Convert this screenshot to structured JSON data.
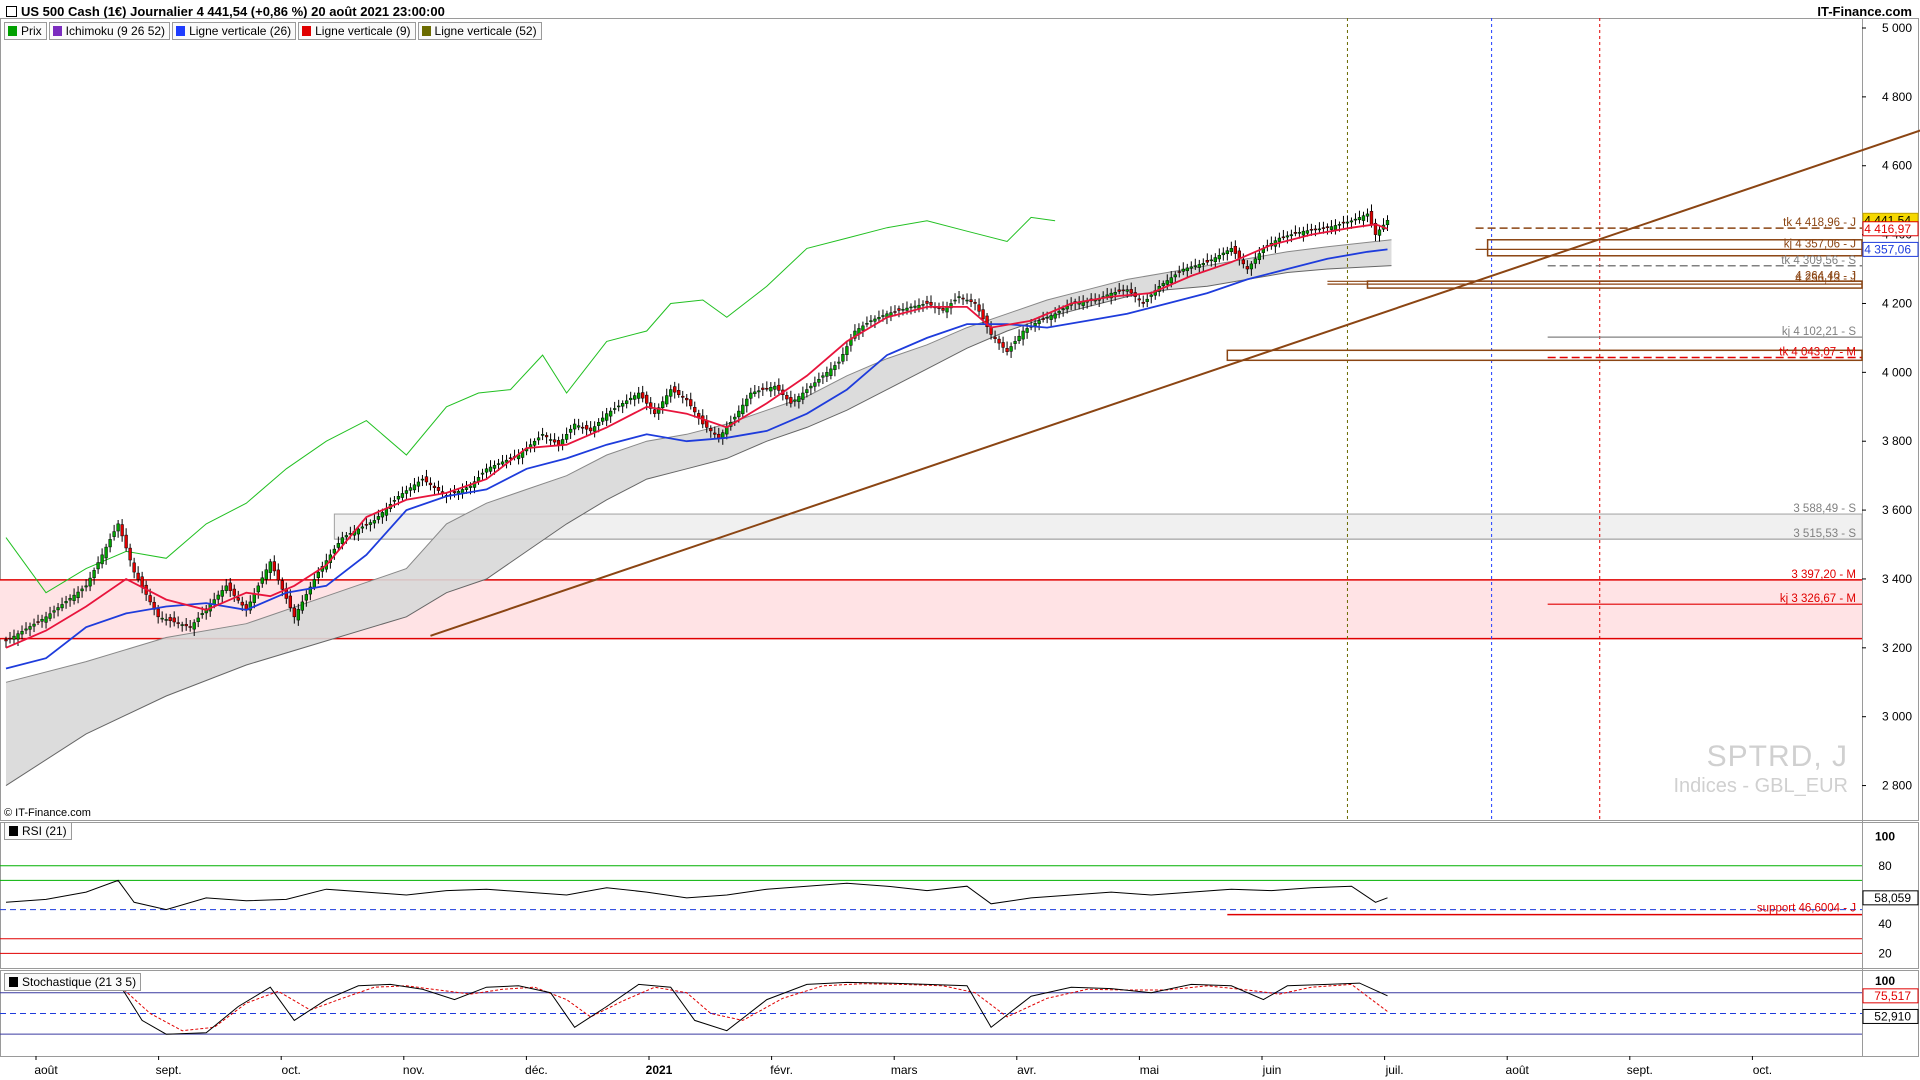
{
  "header": {
    "title": "US 500 Cash (1€) Journalier 4 441,54 (+0,86 %) 20 août 2021 23:00:00",
    "brand": "IT-Finance.com"
  },
  "legend": [
    {
      "label": "Prix",
      "color": "#00a000"
    },
    {
      "label": "Ichimoku (9 26 52)",
      "color": "#7b2cbf"
    },
    {
      "label": "Ligne verticale (26)",
      "color": "#1e3cff"
    },
    {
      "label": "Ligne verticale (9)",
      "color": "#e00000"
    },
    {
      "label": "Ligne verticale (52)",
      "color": "#6b6b00"
    }
  ],
  "copyright": "© IT-Finance.com",
  "watermark": {
    "symbol": "SPTRD, J",
    "market": "Indices - GBL_EUR"
  },
  "rsi_panel": {
    "label": "RSI (21)",
    "value_tag": "58,059",
    "support_label": "support 46,6004 - J"
  },
  "stoch_panel": {
    "label": "Stochastique (21 3 5)",
    "value_tag_k": "75,517",
    "value_tag_d": "52,910"
  },
  "colors": {
    "up": "#00a000",
    "down": "#e00000",
    "tenkan": "#e8143c",
    "kijun": "#1e3cdc",
    "chikou": "#22c022",
    "cloud": "#d8d8d8",
    "trend": "#8b4513"
  },
  "price_tags": [
    {
      "text": "tk 4 418,96 - J",
      "value": 4418.96,
      "color": "#8b4513"
    },
    {
      "text": "kj 4 357,06 - J",
      "value": 4357.06,
      "color": "#8b4513"
    },
    {
      "text": "tk 4 309,56 - S",
      "value": 4309.56,
      "color": "#808080"
    },
    {
      "text": "4 264,40 - J",
      "value": 4264.4,
      "color": "#8b4513"
    },
    {
      "text": "4 256,13 - J",
      "value": 4256.13,
      "color": "#8b4513"
    },
    {
      "text": "kj 4 102,21 - S",
      "value": 4102.21,
      "color": "#808080"
    },
    {
      "text": "tk 4 043,07 - M",
      "value": 4043.07,
      "color": "#e00000"
    },
    {
      "text": "3 588,49 - S",
      "value": 3588.49,
      "color": "#808080"
    },
    {
      "text": "3 515,53 - S",
      "value": 3515.53,
      "color": "#808080"
    },
    {
      "text": "3 397,20 - M",
      "value": 3397.2,
      "color": "#e00000"
    },
    {
      "text": "kj 3 326,67 - M",
      "value": 3326.67,
      "color": "#e00000"
    }
  ],
  "last_tags": [
    {
      "text": "4 441,54",
      "value": 4441.54,
      "bg": "#f5d800",
      "fg": "#000000"
    },
    {
      "text": "4 416,97",
      "value": 4416.97,
      "bg": "#ffffff",
      "fg": "#e00000"
    },
    {
      "text": "4 357,06",
      "value": 4357.06,
      "bg": "#ffffff",
      "fg": "#1e3cdc"
    }
  ],
  "chart_data": {
    "type": "candlestick",
    "title": "US 500 Cash (1€) Journalier",
    "y_ticks": [
      "2 800",
      "3 000",
      "3 200",
      "3 400",
      "3 600",
      "3 800",
      "4 000",
      "4 200",
      "4 400",
      "4 600",
      "4 800",
      "5 000"
    ],
    "y_tick_values": [
      2800,
      3000,
      3200,
      3400,
      3600,
      3800,
      4000,
      4200,
      4400,
      4600,
      4800,
      5000
    ],
    "ylim": [
      2700,
      5000
    ],
    "x_labels": [
      "août",
      "sept.",
      "oct.",
      "nov.",
      "déc.",
      "2021",
      "févr.",
      "mars",
      "avr.",
      "mai",
      "juin",
      "juil.",
      "août",
      "sept.",
      "oct."
    ],
    "price_path": [
      [
        0,
        3220
      ],
      [
        10,
        3290
      ],
      [
        20,
        3380
      ],
      [
        28,
        3560
      ],
      [
        32,
        3420
      ],
      [
        38,
        3290
      ],
      [
        46,
        3260
      ],
      [
        55,
        3380
      ],
      [
        60,
        3310
      ],
      [
        66,
        3450
      ],
      [
        72,
        3290
      ],
      [
        78,
        3420
      ],
      [
        84,
        3520
      ],
      [
        92,
        3570
      ],
      [
        98,
        3640
      ],
      [
        104,
        3690
      ],
      [
        110,
        3640
      ],
      [
        116,
        3670
      ],
      [
        120,
        3720
      ],
      [
        128,
        3760
      ],
      [
        134,
        3820
      ],
      [
        138,
        3790
      ],
      [
        142,
        3850
      ],
      [
        146,
        3830
      ],
      [
        150,
        3880
      ],
      [
        158,
        3940
      ],
      [
        162,
        3880
      ],
      [
        166,
        3950
      ],
      [
        170,
        3920
      ],
      [
        174,
        3850
      ],
      [
        178,
        3810
      ],
      [
        182,
        3870
      ],
      [
        186,
        3940
      ],
      [
        192,
        3960
      ],
      [
        196,
        3910
      ],
      [
        202,
        3970
      ],
      [
        208,
        4030
      ],
      [
        212,
        4120
      ],
      [
        216,
        4150
      ],
      [
        220,
        4170
      ],
      [
        226,
        4190
      ],
      [
        230,
        4200
      ],
      [
        234,
        4180
      ],
      [
        238,
        4220
      ],
      [
        242,
        4200
      ],
      [
        246,
        4110
      ],
      [
        250,
        4060
      ],
      [
        254,
        4120
      ],
      [
        258,
        4150
      ],
      [
        262,
        4170
      ],
      [
        266,
        4200
      ],
      [
        272,
        4210
      ],
      [
        276,
        4230
      ],
      [
        280,
        4240
      ],
      [
        284,
        4200
      ],
      [
        288,
        4250
      ],
      [
        294,
        4300
      ],
      [
        300,
        4320
      ],
      [
        306,
        4360
      ],
      [
        310,
        4300
      ],
      [
        314,
        4360
      ],
      [
        318,
        4390
      ],
      [
        324,
        4410
      ],
      [
        330,
        4420
      ],
      [
        336,
        4440
      ],
      [
        340,
        4460
      ],
      [
        342,
        4400
      ],
      [
        345,
        4441.54
      ]
    ],
    "chikou_path": [
      [
        0,
        3520
      ],
      [
        10,
        3360
      ],
      [
        20,
        3430
      ],
      [
        30,
        3480
      ],
      [
        40,
        3460
      ],
      [
        50,
        3560
      ],
      [
        60,
        3620
      ],
      [
        70,
        3720
      ],
      [
        80,
        3800
      ],
      [
        90,
        3860
      ],
      [
        100,
        3760
      ],
      [
        110,
        3900
      ],
      [
        118,
        3940
      ],
      [
        126,
        3950
      ],
      [
        134,
        4050
      ],
      [
        140,
        3940
      ],
      [
        150,
        4090
      ],
      [
        160,
        4120
      ],
      [
        166,
        4200
      ],
      [
        174,
        4210
      ],
      [
        180,
        4160
      ],
      [
        190,
        4250
      ],
      [
        200,
        4360
      ],
      [
        210,
        4390
      ],
      [
        220,
        4420
      ],
      [
        230,
        4440
      ],
      [
        240,
        4410
      ],
      [
        250,
        4380
      ],
      [
        256,
        4450
      ],
      [
        262,
        4440
      ]
    ],
    "tenkan_path": [
      [
        0,
        3200
      ],
      [
        10,
        3250
      ],
      [
        20,
        3320
      ],
      [
        30,
        3400
      ],
      [
        40,
        3340
      ],
      [
        50,
        3310
      ],
      [
        60,
        3360
      ],
      [
        66,
        3350
      ],
      [
        72,
        3380
      ],
      [
        80,
        3440
      ],
      [
        90,
        3580
      ],
      [
        100,
        3630
      ],
      [
        110,
        3650
      ],
      [
        120,
        3690
      ],
      [
        130,
        3780
      ],
      [
        140,
        3790
      ],
      [
        150,
        3840
      ],
      [
        160,
        3900
      ],
      [
        170,
        3880
      ],
      [
        180,
        3840
      ],
      [
        190,
        3910
      ],
      [
        200,
        3990
      ],
      [
        210,
        4090
      ],
      [
        220,
        4160
      ],
      [
        230,
        4190
      ],
      [
        240,
        4190
      ],
      [
        246,
        4130
      ],
      [
        256,
        4150
      ],
      [
        266,
        4200
      ],
      [
        276,
        4220
      ],
      [
        286,
        4230
      ],
      [
        296,
        4280
      ],
      [
        306,
        4320
      ],
      [
        316,
        4370
      ],
      [
        326,
        4400
      ],
      [
        336,
        4420
      ],
      [
        342,
        4430
      ],
      [
        345,
        4416.97
      ]
    ],
    "kijun_path": [
      [
        0,
        3140
      ],
      [
        10,
        3170
      ],
      [
        20,
        3260
      ],
      [
        30,
        3300
      ],
      [
        40,
        3320
      ],
      [
        50,
        3330
      ],
      [
        60,
        3310
      ],
      [
        70,
        3360
      ],
      [
        80,
        3380
      ],
      [
        90,
        3470
      ],
      [
        100,
        3600
      ],
      [
        110,
        3640
      ],
      [
        120,
        3660
      ],
      [
        130,
        3720
      ],
      [
        140,
        3750
      ],
      [
        150,
        3790
      ],
      [
        160,
        3820
      ],
      [
        170,
        3800
      ],
      [
        180,
        3810
      ],
      [
        190,
        3830
      ],
      [
        200,
        3880
      ],
      [
        210,
        3950
      ],
      [
        220,
        4050
      ],
      [
        230,
        4100
      ],
      [
        240,
        4140
      ],
      [
        250,
        4140
      ],
      [
        260,
        4130
      ],
      [
        270,
        4150
      ],
      [
        280,
        4170
      ],
      [
        290,
        4200
      ],
      [
        300,
        4230
      ],
      [
        310,
        4270
      ],
      [
        320,
        4300
      ],
      [
        330,
        4330
      ],
      [
        340,
        4350
      ],
      [
        345,
        4357.06
      ]
    ],
    "cloud_upper": [
      [
        0,
        3100
      ],
      [
        20,
        3160
      ],
      [
        40,
        3230
      ],
      [
        60,
        3270
      ],
      [
        80,
        3350
      ],
      [
        100,
        3430
      ],
      [
        110,
        3560
      ],
      [
        120,
        3620
      ],
      [
        130,
        3660
      ],
      [
        140,
        3700
      ],
      [
        150,
        3760
      ],
      [
        160,
        3800
      ],
      [
        170,
        3820
      ],
      [
        180,
        3850
      ],
      [
        190,
        3890
      ],
      [
        200,
        3930
      ],
      [
        210,
        3990
      ],
      [
        220,
        4040
      ],
      [
        230,
        4080
      ],
      [
        240,
        4130
      ],
      [
        250,
        4170
      ],
      [
        260,
        4210
      ],
      [
        270,
        4240
      ],
      [
        280,
        4270
      ],
      [
        290,
        4290
      ],
      [
        300,
        4310
      ],
      [
        310,
        4330
      ],
      [
        320,
        4350
      ],
      [
        330,
        4365
      ],
      [
        346,
        4385
      ]
    ],
    "cloud_lower": [
      [
        0,
        2800
      ],
      [
        20,
        2950
      ],
      [
        40,
        3060
      ],
      [
        60,
        3150
      ],
      [
        80,
        3220
      ],
      [
        100,
        3290
      ],
      [
        110,
        3360
      ],
      [
        120,
        3400
      ],
      [
        130,
        3480
      ],
      [
        140,
        3560
      ],
      [
        150,
        3630
      ],
      [
        160,
        3690
      ],
      [
        170,
        3720
      ],
      [
        180,
        3750
      ],
      [
        190,
        3800
      ],
      [
        200,
        3840
      ],
      [
        210,
        3890
      ],
      [
        220,
        3950
      ],
      [
        230,
        4010
      ],
      [
        240,
        4070
      ],
      [
        250,
        4120
      ],
      [
        260,
        4160
      ],
      [
        270,
        4190
      ],
      [
        280,
        4220
      ],
      [
        290,
        4240
      ],
      [
        300,
        4250
      ],
      [
        310,
        4270
      ],
      [
        320,
        4290
      ],
      [
        330,
        4300
      ],
      [
        346,
        4310
      ]
    ],
    "rsi_path": [
      [
        0,
        55
      ],
      [
        10,
        57
      ],
      [
        20,
        62
      ],
      [
        28,
        70
      ],
      [
        32,
        55
      ],
      [
        40,
        50
      ],
      [
        50,
        58
      ],
      [
        60,
        56
      ],
      [
        70,
        57
      ],
      [
        80,
        64
      ],
      [
        90,
        62
      ],
      [
        100,
        60
      ],
      [
        110,
        63
      ],
      [
        120,
        64
      ],
      [
        130,
        62
      ],
      [
        140,
        60
      ],
      [
        150,
        65
      ],
      [
        160,
        62
      ],
      [
        170,
        58
      ],
      [
        180,
        60
      ],
      [
        190,
        64
      ],
      [
        200,
        66
      ],
      [
        210,
        68
      ],
      [
        220,
        66
      ],
      [
        230,
        63
      ],
      [
        240,
        66
      ],
      [
        246,
        54
      ],
      [
        256,
        58
      ],
      [
        266,
        60
      ],
      [
        276,
        62
      ],
      [
        286,
        60
      ],
      [
        296,
        62
      ],
      [
        306,
        64
      ],
      [
        316,
        63
      ],
      [
        326,
        65
      ],
      [
        336,
        66
      ],
      [
        342,
        55
      ],
      [
        345,
        58.06
      ]
    ],
    "stoch_k": [
      [
        0,
        90
      ],
      [
        10,
        88
      ],
      [
        20,
        92
      ],
      [
        28,
        95
      ],
      [
        34,
        40
      ],
      [
        40,
        20
      ],
      [
        50,
        22
      ],
      [
        58,
        60
      ],
      [
        66,
        88
      ],
      [
        72,
        40
      ],
      [
        80,
        70
      ],
      [
        88,
        90
      ],
      [
        96,
        92
      ],
      [
        104,
        85
      ],
      [
        112,
        70
      ],
      [
        120,
        88
      ],
      [
        128,
        90
      ],
      [
        136,
        80
      ],
      [
        142,
        30
      ],
      [
        150,
        60
      ],
      [
        158,
        92
      ],
      [
        166,
        88
      ],
      [
        172,
        40
      ],
      [
        180,
        25
      ],
      [
        190,
        70
      ],
      [
        200,
        92
      ],
      [
        210,
        95
      ],
      [
        220,
        94
      ],
      [
        230,
        92
      ],
      [
        240,
        90
      ],
      [
        246,
        30
      ],
      [
        256,
        75
      ],
      [
        266,
        88
      ],
      [
        276,
        86
      ],
      [
        286,
        80
      ],
      [
        296,
        92
      ],
      [
        306,
        90
      ],
      [
        314,
        70
      ],
      [
        320,
        90
      ],
      [
        330,
        92
      ],
      [
        338,
        94
      ],
      [
        345,
        75.5
      ]
    ],
    "stoch_d": [
      [
        0,
        88
      ],
      [
        10,
        87
      ],
      [
        20,
        90
      ],
      [
        28,
        92
      ],
      [
        36,
        50
      ],
      [
        44,
        25
      ],
      [
        52,
        30
      ],
      [
        60,
        65
      ],
      [
        68,
        82
      ],
      [
        76,
        55
      ],
      [
        84,
        72
      ],
      [
        92,
        88
      ],
      [
        100,
        90
      ],
      [
        108,
        84
      ],
      [
        116,
        78
      ],
      [
        124,
        85
      ],
      [
        132,
        88
      ],
      [
        140,
        70
      ],
      [
        146,
        45
      ],
      [
        154,
        68
      ],
      [
        162,
        88
      ],
      [
        170,
        80
      ],
      [
        176,
        50
      ],
      [
        184,
        40
      ],
      [
        194,
        72
      ],
      [
        204,
        90
      ],
      [
        214,
        93
      ],
      [
        224,
        92
      ],
      [
        234,
        90
      ],
      [
        242,
        80
      ],
      [
        250,
        45
      ],
      [
        260,
        72
      ],
      [
        270,
        85
      ],
      [
        280,
        84
      ],
      [
        290,
        84
      ],
      [
        300,
        90
      ],
      [
        310,
        84
      ],
      [
        318,
        78
      ],
      [
        326,
        88
      ],
      [
        336,
        92
      ],
      [
        345,
        52.9
      ]
    ],
    "rsi_ticks": [
      "20",
      "40",
      "60",
      "80",
      "100"
    ],
    "stoch_ticks": [
      "100"
    ]
  }
}
